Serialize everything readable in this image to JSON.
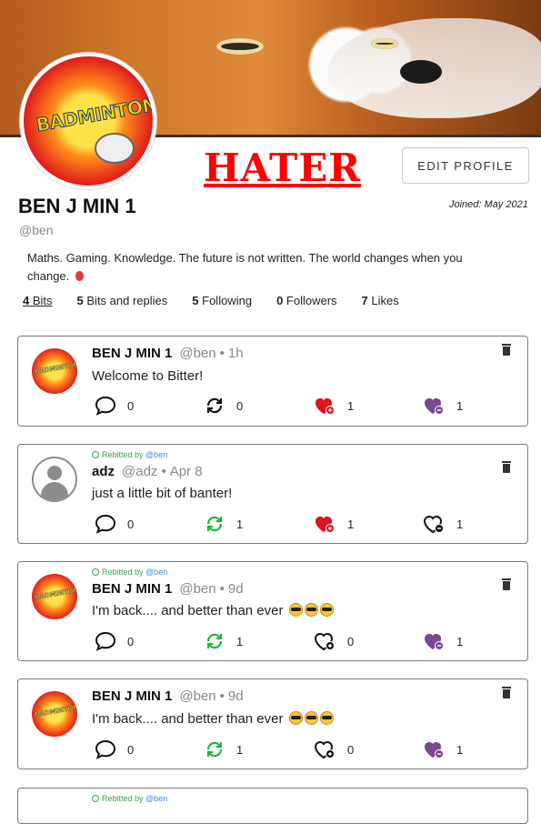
{
  "profile": {
    "title": "HATER",
    "edit_button": "EDIT PROFILE",
    "display_name": "BEN J MIN 1",
    "handle": "@ben",
    "joined": "Joined: May 2021",
    "bio": "Maths. Gaming. Knowledge. The future is not written. The world changes when you change.",
    "avatar_text": "BADMINTON"
  },
  "stats": [
    {
      "count": "4",
      "label": "Bits"
    },
    {
      "count": "5",
      "label": "Bits and replies"
    },
    {
      "count": "5",
      "label": "Following"
    },
    {
      "count": "0",
      "label": "Followers"
    },
    {
      "count": "7",
      "label": "Likes"
    }
  ],
  "posts": [
    {
      "rebit": "",
      "rebit_by": "",
      "name": "BEN J MIN 1",
      "handle": "@ben",
      "time": "1h",
      "text": "Welcome to Bitter!",
      "replies": "0",
      "rebits": "0",
      "likes": "1",
      "dislikes": "1",
      "rebitted": false,
      "liked": true,
      "disliked": true
    },
    {
      "rebit": "Rebitted by",
      "rebit_by": "@ben",
      "name": "adz",
      "handle": "@adz",
      "time": "Apr 8",
      "text": "just a little bit of banter!",
      "replies": "0",
      "rebits": "1",
      "likes": "1",
      "dislikes": "1",
      "rebitted": true,
      "liked": true,
      "disliked": false
    },
    {
      "rebit": "Rebitted by",
      "rebit_by": "@ben",
      "name": "BEN J MIN 1",
      "handle": "@ben",
      "time": "9d",
      "text": "I'm back.... and better than ever",
      "replies": "0",
      "rebits": "1",
      "likes": "0",
      "dislikes": "1",
      "rebitted": true,
      "liked": false,
      "disliked": true
    },
    {
      "rebit": "",
      "rebit_by": "",
      "name": "BEN J MIN 1",
      "handle": "@ben",
      "time": "9d",
      "text": "I'm back.... and better than ever",
      "replies": "0",
      "rebits": "1",
      "likes": "0",
      "dislikes": "1",
      "rebitted": true,
      "liked": false,
      "disliked": true
    },
    {
      "rebit": "Rebitted by",
      "rebit_by": "@ben"
    }
  ],
  "colors": {
    "accent_red": "#ff0000",
    "rebit_green": "#2fa84f",
    "dislike_purple": "#7b4a8e",
    "link_blue": "#3a8bd8"
  }
}
